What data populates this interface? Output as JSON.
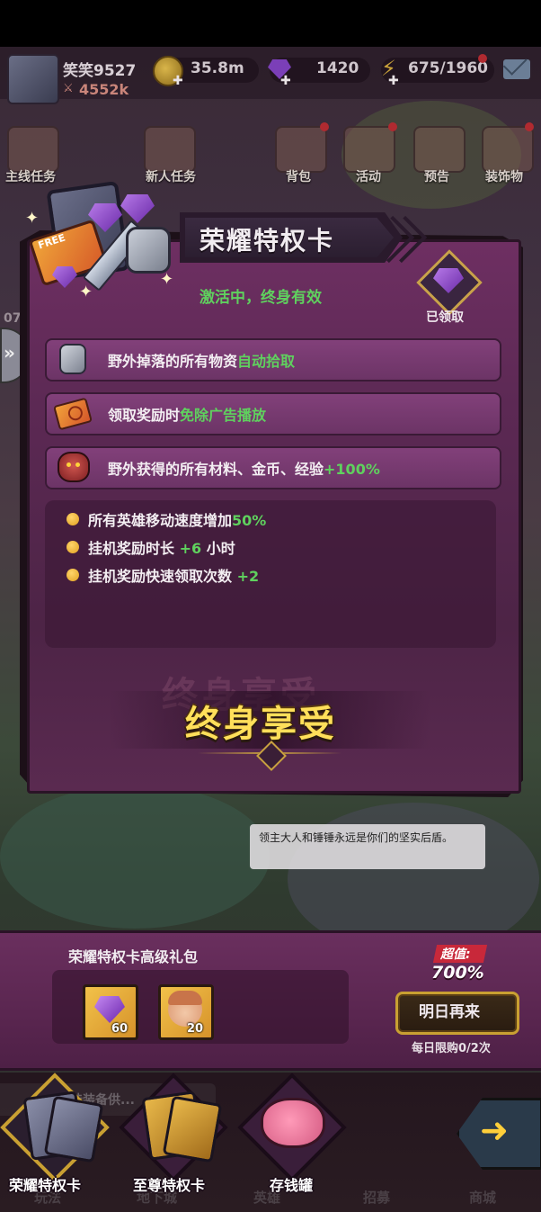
{
  "topbar": {
    "player_name": "笑笑9527",
    "power": "4552k",
    "gold": "35.8m",
    "gems": "1420",
    "stamina": "675/1960"
  },
  "menu": [
    "主线任务",
    "新人任务",
    "背包",
    "活动",
    "预告",
    "装饰物"
  ],
  "side_number": "07",
  "card": {
    "title": "荣耀特权卡",
    "status": "激活中，终身有效",
    "claimed_label": "已领取",
    "art_free": "FREE",
    "rows": [
      {
        "text": "野外掉落的所有物资",
        "highlight": "自动拾取",
        "icon": "gauntlet-icon"
      },
      {
        "text": "领取奖励时",
        "highlight": "免除广告播放",
        "icon": "ticket-icon"
      },
      {
        "text": "野外获得的所有材料、金币、经验",
        "highlight": "+100%",
        "icon": "boar-icon"
      }
    ],
    "bullets": [
      {
        "text": "所有英雄移动速度增加",
        "highlight": "50%"
      },
      {
        "text": "挂机奖励时长",
        "highlight": "+6",
        "suffix": "小时"
      },
      {
        "text": "挂机奖励快速领取次数",
        "highlight": "+2"
      }
    ],
    "enjoy": "终身享受",
    "colors": {
      "highlight": "#5fd15e",
      "enjoy": "#ffdf5a"
    }
  },
  "speech_bubble": "领主大人和锤锤永远是你们的坚实后盾。",
  "bundle": {
    "title": "荣耀特权卡高级礼包",
    "items": [
      {
        "icon": "purple-gem-icon",
        "count": "60"
      },
      {
        "icon": "hero-portrait-icon",
        "count": "20"
      }
    ],
    "value_label": "超值:",
    "value_pct": "700%",
    "button_label": "明日再来",
    "daily_limit": "每日限购0/2次"
  },
  "chat_text": "挂装备供...",
  "nav_underlay": [
    "玩法",
    "地下城",
    "英雄",
    "招募",
    "商城"
  ],
  "nav": [
    {
      "label": "荣耀特权卡",
      "active": true
    },
    {
      "label": "至尊特权卡",
      "active": false
    },
    {
      "label": "存钱罐",
      "active": false
    }
  ]
}
